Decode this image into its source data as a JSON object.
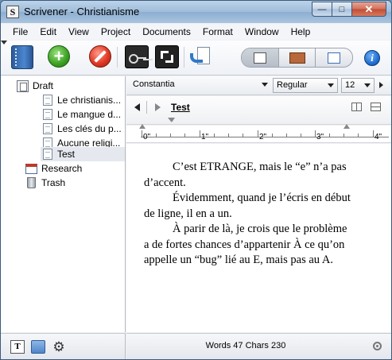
{
  "window": {
    "title": "Scrivener - Christianisme"
  },
  "menu": [
    "File",
    "Edit",
    "View",
    "Project",
    "Documents",
    "Format",
    "Window",
    "Help"
  ],
  "toolbar": {
    "icons": [
      "binder-icon",
      "add-icon",
      "delete-icon",
      "keywords-icon",
      "fullscreen-icon",
      "compile-icon",
      "scrivenings-icon",
      "corkboard-icon",
      "outliner-icon",
      "inspector-icon"
    ]
  },
  "binder": {
    "draft": "Draft",
    "items": [
      "Le christianis...",
      "Le mangue d...",
      "Les clés du p...",
      "Aucune religi...",
      "Test"
    ],
    "research": "Research",
    "trash": "Trash"
  },
  "format": {
    "font": "Constantia",
    "style": "Regular",
    "size": "12"
  },
  "editor": {
    "doc_title": "Test",
    "paragraphs": [
      "C’est ETRANGE, mais le “e” n’a pas d’accent.",
      "Évidemment, quand je l’écris en début de ligne, il en a un.",
      "À parir de là, je crois que le problème a de fortes chances d’appartenir À ce qu’on appelle un “bug” lié au E, mais pas au A."
    ],
    "ruler_labels": [
      "0\"",
      "1\"",
      "2\"",
      "3\"",
      "4\""
    ],
    "status": "Words 47 Chars 230"
  },
  "colors": {
    "accent": "#2f78c9",
    "add": "#3aa021",
    "delete": "#e03a26"
  }
}
